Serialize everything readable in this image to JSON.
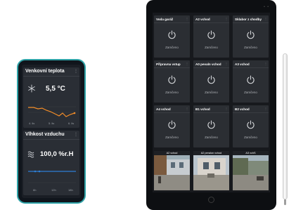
{
  "phone": {
    "temp_card": {
      "title": "Venkovní teplota",
      "menu_glyph": "⋮",
      "icon": "snowflake-icon",
      "value": "5,5 °C",
      "chart_ticks": [
        "4. lis",
        "5. lis",
        "6. lis"
      ]
    },
    "humidity_card": {
      "title": "Vlhkost vzduchu",
      "menu_glyph": "⋮",
      "icon": "humidity-icon",
      "value": "100,0 %r.H",
      "chart_ticks": [
        "6h",
        "12h",
        "18h"
      ]
    }
  },
  "tablet": {
    "camera_dots": "• •",
    "tiles": [
      {
        "title": "Voda garáž",
        "status": "Zamčeno"
      },
      {
        "title": "A2 vchod",
        "status": "Zamčeno"
      },
      {
        "title": "Sklabor z chodby",
        "status": "Zamčeno"
      },
      {
        "title": "Přípravna vstup",
        "status": "Zamčeno"
      },
      {
        "title": "A0 pevaln vchod",
        "status": "Zamčeno"
      },
      {
        "title": "A3 vchod",
        "status": "Zamčeno"
      },
      {
        "title": "A4 vchod",
        "status": "Zamčeno"
      },
      {
        "title": "B1 vchod",
        "status": "Zamčeno"
      },
      {
        "title": "B2 vchod",
        "status": "Zamčeno"
      }
    ],
    "tile_menu_glyph": "⋮",
    "cameras": [
      {
        "title": "A2 vchod"
      },
      {
        "title": "A2 peralon vchod"
      },
      {
        "title": "A3 vchS"
      }
    ]
  },
  "colors": {
    "accent_teal": "#2fa3a8",
    "chart_orange": "#f28c28",
    "chart_blue": "#2f7fd6",
    "tile_bg": "#2b2e33"
  }
}
